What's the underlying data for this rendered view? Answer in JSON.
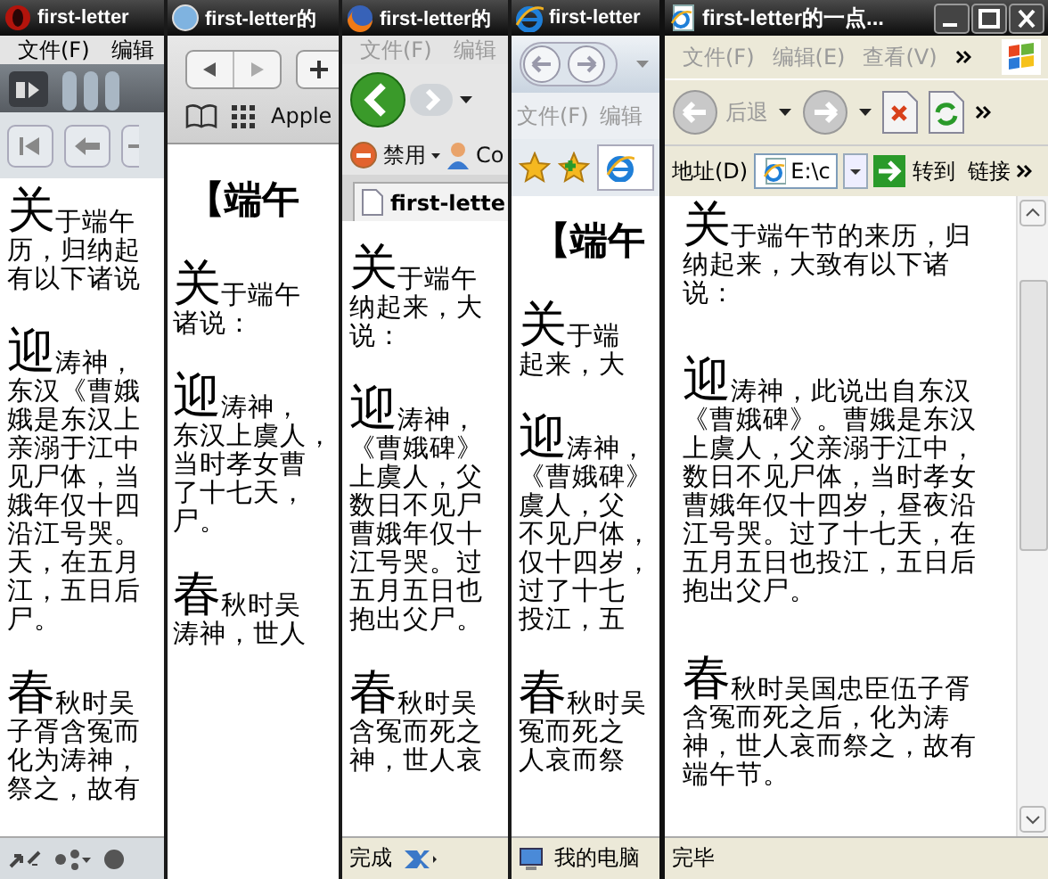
{
  "windows": [
    {
      "kind": "opera",
      "title": "first-letter",
      "menu": [
        "文件(F)",
        "编辑"
      ],
      "paragraphs": [
        {
          "initial": "关",
          "lines": [
            "于端午",
            "历，归纳起",
            "有以下诸说"
          ]
        },
        {
          "initial": "迎",
          "lines": [
            "涛神，",
            "东汉《曹娥",
            "娥是东汉上",
            "亲溺于江中",
            "见尸体，当",
            "娥年仅十四",
            "沿江号哭。",
            "天，在五月",
            "江，五日后",
            "尸。"
          ]
        },
        {
          "initial": "春",
          "lines": [
            "秋时吴",
            "子胥含冤而",
            "化为涛神，",
            "祭之，故有"
          ]
        }
      ]
    },
    {
      "kind": "safari",
      "title": "first-letter的",
      "bookmark": "Apple",
      "heading": "【端午",
      "paragraphs": [
        {
          "initial": "关",
          "lines": [
            "于端午",
            "诸说："
          ]
        },
        {
          "initial": "迎",
          "lines": [
            "涛神，",
            "东汉上虞人，",
            "当时孝女曹",
            "了十七天，",
            "尸。"
          ]
        },
        {
          "initial": "春",
          "lines": [
            "秋时吴",
            "涛神，世人"
          ]
        }
      ]
    },
    {
      "kind": "firefox",
      "title": "first-letter的",
      "menu": [
        "文件(F)",
        "编辑"
      ],
      "bookmarks": [
        "禁用",
        "Co"
      ],
      "tab": "first-lette",
      "status": "完成",
      "paragraphs": [
        {
          "initial": "关",
          "lines": [
            "于端午",
            "纳起来，大",
            "说："
          ]
        },
        {
          "initial": "迎",
          "lines": [
            "涛神，",
            "《曹娥碑》",
            "上虞人，父",
            "数日不见尸",
            "曹娥年仅十",
            "江号哭。过",
            "五月五日也",
            "抱出父尸。"
          ]
        },
        {
          "initial": "春",
          "lines": [
            "秋时吴",
            "含冤而死之",
            "神，世人哀"
          ]
        }
      ]
    },
    {
      "kind": "ie7",
      "title": "first-letter",
      "menu": [
        "文件(F)",
        "编辑"
      ],
      "heading": "【端午",
      "status": "我的电脑",
      "paragraphs": [
        {
          "initial": "关",
          "lines": [
            "于端",
            "起来，大"
          ]
        },
        {
          "initial": "迎",
          "lines": [
            "涛神，",
            "《曹娥碑》",
            "虞人，父",
            "不见尸体，",
            "仅十四岁，",
            "过了十七",
            "投江，五"
          ]
        },
        {
          "initial": "春",
          "lines": [
            "秋时吴",
            "冤而死之",
            "人哀而祭"
          ]
        }
      ]
    },
    {
      "kind": "ie6",
      "title": "first-letter的一点...",
      "menu": [
        "文件(F)",
        "编辑(E)",
        "查看(V)"
      ],
      "back": "后退",
      "address_label": "地址(D)",
      "address": "E:\\c",
      "go": "转到",
      "links": "链接",
      "status": "完毕",
      "paragraphs": [
        {
          "initial": "关",
          "lines": [
            "于端午节的来历，归",
            "纳起来，大致有以下诸",
            "说："
          ]
        },
        {
          "initial": "迎",
          "lines": [
            "涛神，此说出自东汉",
            "《曹娥碑》。曹娥是东汉",
            "上虞人，父亲溺于江中，",
            "数日不见尸体，当时孝女",
            "曹娥年仅十四岁，昼夜沿",
            "江号哭。过了十七天，在",
            "五月五日也投江，五日后",
            "抱出父尸。"
          ]
        },
        {
          "initial": "春",
          "lines": [
            "秋时吴国忠臣伍子胥",
            "含冤而死之后，化为涛",
            "神，世人哀而祭之，故有",
            "端午节。"
          ]
        }
      ]
    }
  ]
}
